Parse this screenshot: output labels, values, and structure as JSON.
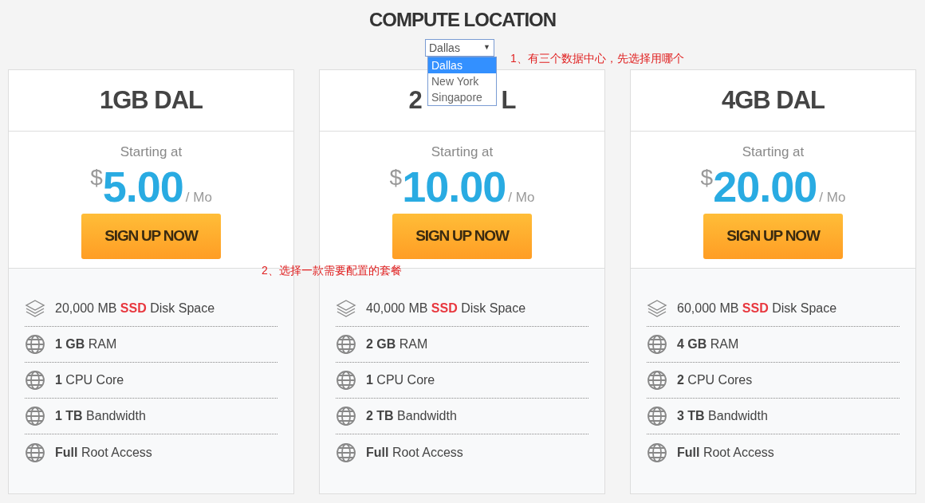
{
  "title": "COMPUTE LOCATION",
  "location_select": {
    "value": "Dallas",
    "caret": "▼",
    "expanded": true,
    "options": [
      {
        "label": "Dallas",
        "selected": true
      },
      {
        "label": "New York",
        "selected": false
      },
      {
        "label": "Singapore",
        "selected": false
      }
    ]
  },
  "annotations": [
    "1、有三个数据中心，先选择用哪个",
    "2、选择一款需要配置的套餐"
  ],
  "plans": [
    {
      "name": "1GB DAL",
      "starting": "Starting at",
      "currency": "$",
      "price": "5.00",
      "period": "/ Mo",
      "button": "SIGN UP NOW",
      "features": [
        {
          "kind": "disk",
          "text": "20,000 MB **SSD** Disk Space"
        },
        {
          "kind": "globe",
          "text": "**1 GB** RAM"
        },
        {
          "kind": "globe",
          "text": "**1** CPU Core"
        },
        {
          "kind": "globe",
          "text": "**1 TB** Bandwidth"
        },
        {
          "kind": "globe",
          "text": "**Full** Root Access"
        }
      ]
    },
    {
      "name_parts": [
        "2",
        "L"
      ],
      "starting": "Starting at",
      "currency": "$",
      "price": "10.00",
      "period": "/ Mo",
      "button": "SIGN UP NOW",
      "features": [
        {
          "kind": "disk",
          "text": "40,000 MB **SSD** Disk Space"
        },
        {
          "kind": "globe",
          "text": "**2 GB** RAM"
        },
        {
          "kind": "globe",
          "text": "**1** CPU Core"
        },
        {
          "kind": "globe",
          "text": "**2 TB** Bandwidth"
        },
        {
          "kind": "globe",
          "text": "**Full** Root Access"
        }
      ]
    },
    {
      "name": "4GB DAL",
      "starting": "Starting at",
      "currency": "$",
      "price": "20.00",
      "period": "/ Mo",
      "button": "SIGN UP NOW",
      "features": [
        {
          "kind": "disk",
          "text": "60,000 MB **SSD** Disk Space"
        },
        {
          "kind": "globe",
          "text": "**4 GB** RAM"
        },
        {
          "kind": "globe",
          "text": "**2** CPU Cores"
        },
        {
          "kind": "globe",
          "text": "**3 TB** Bandwidth"
        },
        {
          "kind": "globe",
          "text": "**Full** Root Access"
        }
      ]
    }
  ]
}
